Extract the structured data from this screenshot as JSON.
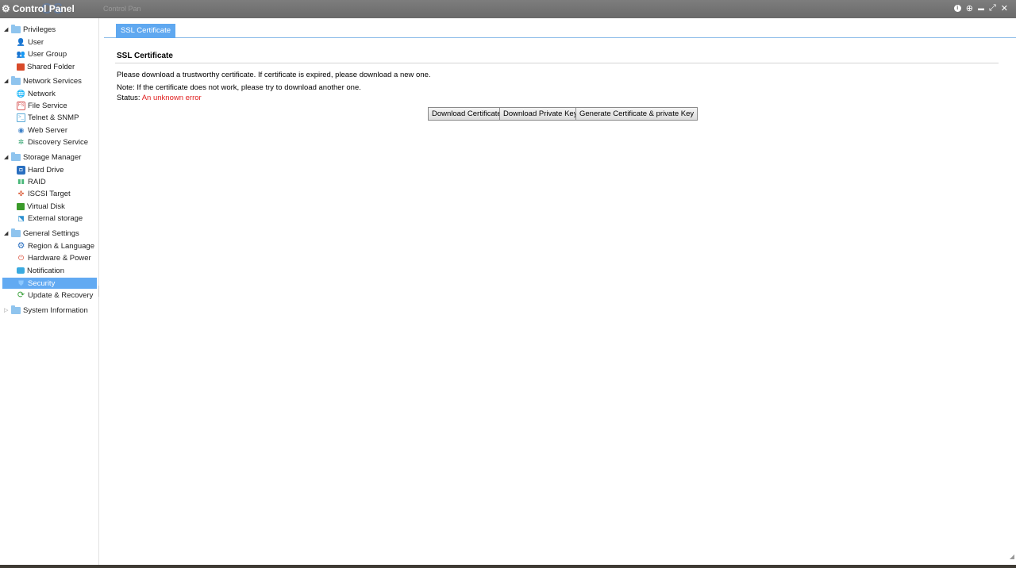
{
  "titlebar": {
    "title": "Control Panel",
    "logo_ghost": "OS",
    "behind_window": "Control Pan",
    "info_icon": "i",
    "globe_icon": "⊕",
    "minimize": "▬",
    "restore": "⤢",
    "close": "✕"
  },
  "sidebar": {
    "groups": [
      {
        "label": "Privileges",
        "items": [
          "User",
          "User Group",
          "Shared Folder"
        ]
      },
      {
        "label": "Network Services",
        "items": [
          "Network",
          "File Service",
          "Telnet & SNMP",
          "Web Server",
          "Discovery Service"
        ]
      },
      {
        "label": "Storage Manager",
        "items": [
          "Hard Drive",
          "RAID",
          "ISCSI Target",
          "Virtual Disk",
          "External storage"
        ]
      },
      {
        "label": "General Settings",
        "items": [
          "Region & Language",
          "Hardware & Power",
          "Notification",
          "Security",
          "Update & Recovery"
        ]
      },
      {
        "label": "System Information",
        "items": []
      }
    ],
    "selected": "Security"
  },
  "main": {
    "tab": "SSL Certificate",
    "section_title": "SSL Certificate",
    "line1": "Please download a trustworthy certificate. If certificate is expired, please download a new one.",
    "line2": "Note: If the certificate does not work, please try to download another one.",
    "status_label": "Status:",
    "status_value": "An unknown error",
    "buttons": {
      "download_cert": "Download Certificate",
      "download_key": "Download Private Key",
      "generate": "Generate Certificate & private Key"
    }
  },
  "colors": {
    "selected_bg": "#62aaf2",
    "tab_bg": "#5fa8f0",
    "error_text": "#e02020",
    "titlebar_bg": "#757575"
  }
}
